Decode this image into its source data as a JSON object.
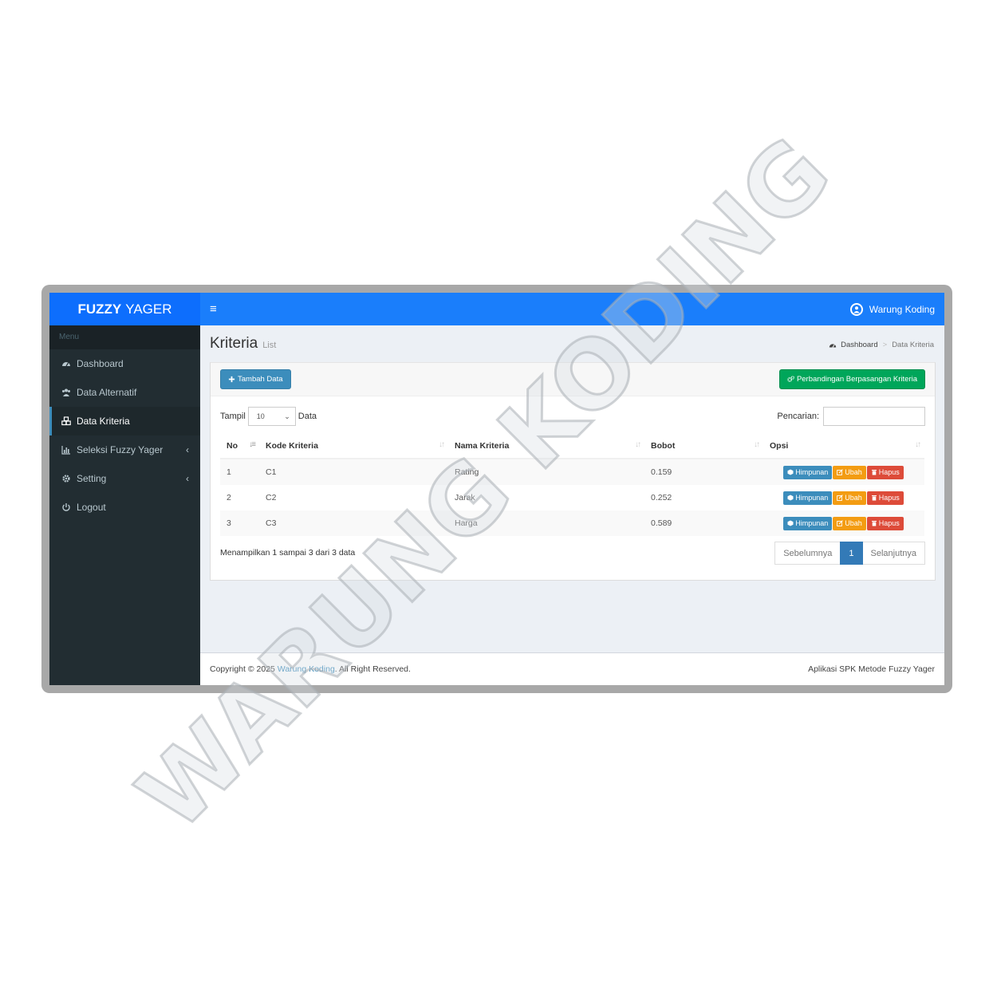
{
  "app": {
    "brand_bold": "FUZZY",
    "brand_rest": "YAGER"
  },
  "header": {
    "user_name": "Warung Koding"
  },
  "sidebar": {
    "menu_label": "Menu",
    "items": [
      {
        "label": "Dashboard",
        "icon": "dashboard-icon"
      },
      {
        "label": "Data Alternatif",
        "icon": "users-icon"
      },
      {
        "label": "Data Kriteria",
        "icon": "cubes-icon"
      },
      {
        "label": "Seleksi Fuzzy Yager",
        "icon": "bar-chart-icon"
      },
      {
        "label": "Setting",
        "icon": "gear-icon"
      },
      {
        "label": "Logout",
        "icon": "power-icon"
      }
    ]
  },
  "page": {
    "title": "Kriteria",
    "subtitle": "List"
  },
  "breadcrumb": {
    "home": "Dashboard",
    "sep": ">",
    "current": "Data Kriteria"
  },
  "toolbar": {
    "add_label": "Tambah Data",
    "compare_label": "Perbandingan Berpasangan Kriteria"
  },
  "table_controls": {
    "show_label": "Tampil",
    "show_value": "10",
    "show_suffix": "Data",
    "search_label": "Pencarian:"
  },
  "table": {
    "headers": [
      "No",
      "Kode Kriteria",
      "Nama Kriteria",
      "Bobot",
      "Opsi"
    ],
    "rows": [
      {
        "no": "1",
        "kode": "C1",
        "nama": "Rating",
        "bobot": "0.159"
      },
      {
        "no": "2",
        "kode": "C2",
        "nama": "Jarak",
        "bobot": "0.252"
      },
      {
        "no": "3",
        "kode": "C3",
        "nama": "Harga",
        "bobot": "0.589"
      }
    ],
    "actions": {
      "himpunan": "Himpunan",
      "ubah": "Ubah",
      "hapus": "Hapus"
    }
  },
  "pagination": {
    "info": "Menampilkan 1 sampai 3 dari 3 data",
    "prev": "Sebelumnya",
    "page": "1",
    "next": "Selanjutnya"
  },
  "footer": {
    "prefix": "Copyright © 2025",
    "link": "Warung Koding",
    "suffix": ". All Right Reserved.",
    "right": "Aplikasi SPK Metode Fuzzy Yager"
  },
  "watermark": {
    "text": "WARUNG KODING"
  },
  "colors": {
    "primary": "#1a7efb",
    "sidebar": "#222d32",
    "success": "#00a65a",
    "warning": "#f39c12",
    "danger": "#dd4b39",
    "info": "#3c8dbc"
  }
}
